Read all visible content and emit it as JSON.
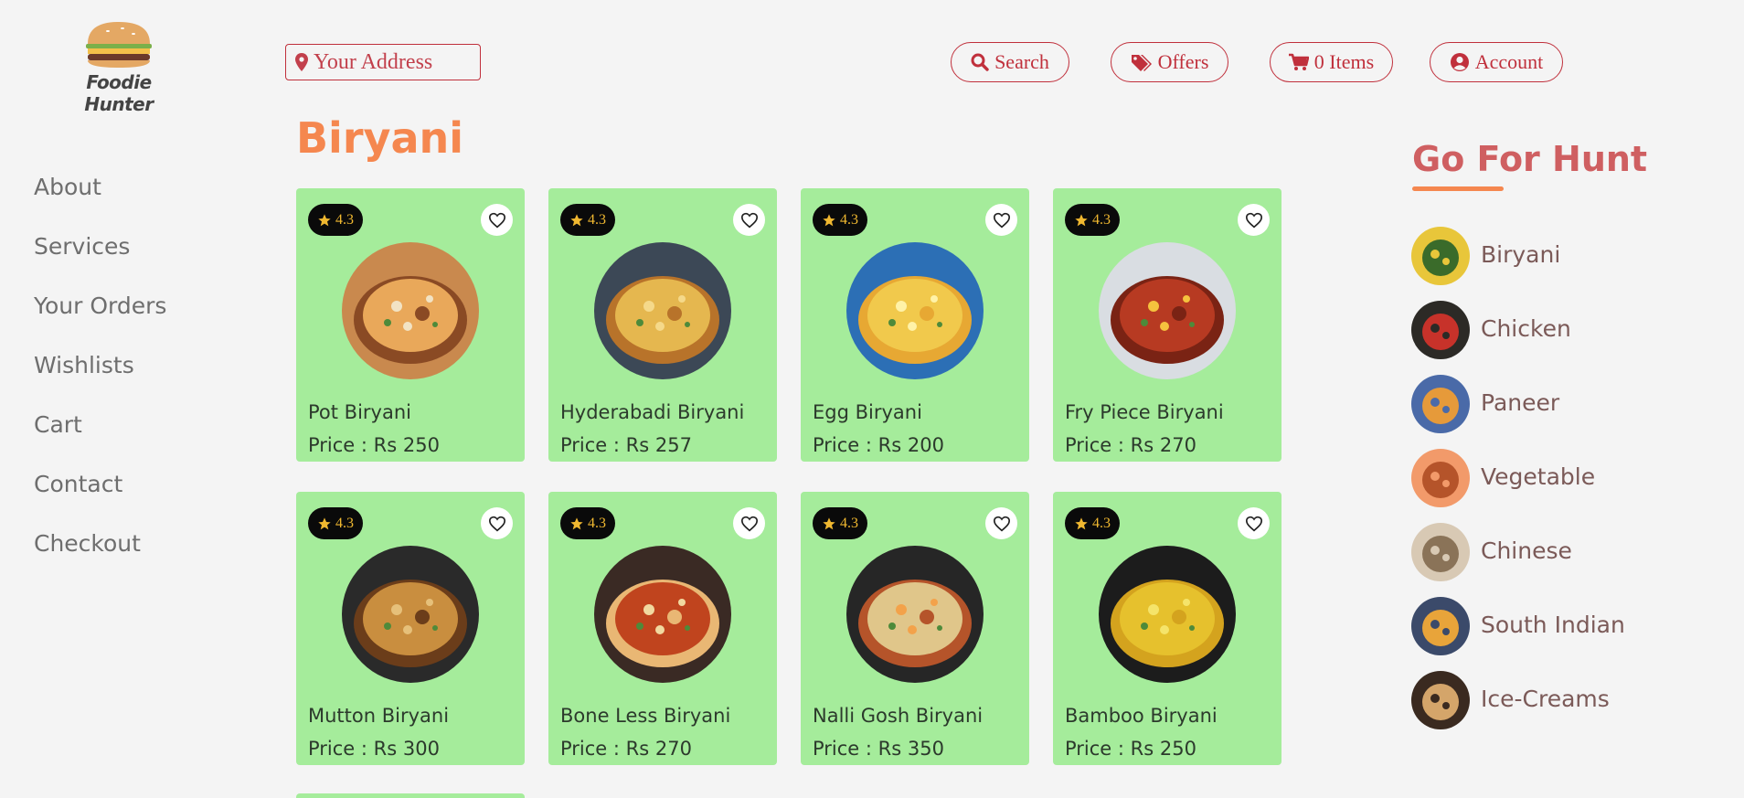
{
  "brand": {
    "name": "Foodie Hunter",
    "logo_icon": "burger-icon"
  },
  "header": {
    "address_placeholder": "Your Address",
    "buttons": [
      {
        "label": "Search",
        "icon": "search-icon"
      },
      {
        "label": "Offers",
        "icon": "tags-icon"
      },
      {
        "label": "0 Items",
        "icon": "cart-icon"
      },
      {
        "label": "Account",
        "icon": "user-circle-icon"
      }
    ]
  },
  "sidebar": {
    "items": [
      "About",
      "Services",
      "Your Orders",
      "Wishlists",
      "Cart",
      "Contact",
      "Checkout"
    ]
  },
  "main": {
    "title": "Biryani",
    "cards": [
      {
        "name": "Pot Biryani",
        "price": "Price : Rs 250",
        "rating": "4.3"
      },
      {
        "name": "Hyderabadi Biryani",
        "price": "Price : Rs 257",
        "rating": "4.3"
      },
      {
        "name": "Egg Biryani",
        "price": "Price : Rs 200",
        "rating": "4.3"
      },
      {
        "name": "Fry Piece Biryani",
        "price": "Price : Rs 270",
        "rating": "4.3"
      },
      {
        "name": "Mutton Biryani",
        "price": "Price : Rs 300",
        "rating": "4.3"
      },
      {
        "name": "Bone Less Biryani",
        "price": "Price : Rs 270",
        "rating": "4.3"
      },
      {
        "name": "Nalli Gosh Biryani",
        "price": "Price : Rs 350",
        "rating": "4.3"
      },
      {
        "name": "Bamboo Biryani",
        "price": "Price : Rs 250",
        "rating": "4.3"
      }
    ]
  },
  "categories": {
    "title": "Go For Hunt",
    "items": [
      "Biryani",
      "Chicken",
      "Paneer",
      "Vegetable",
      "Chinese",
      "South Indian",
      "Ice-Creams"
    ]
  },
  "colors": {
    "accent": "#c0303c",
    "title_orange": "#f5874f",
    "card_green": "#a5ec9b",
    "hunt_title": "#cf5f61",
    "background": "#f4f4f4"
  }
}
